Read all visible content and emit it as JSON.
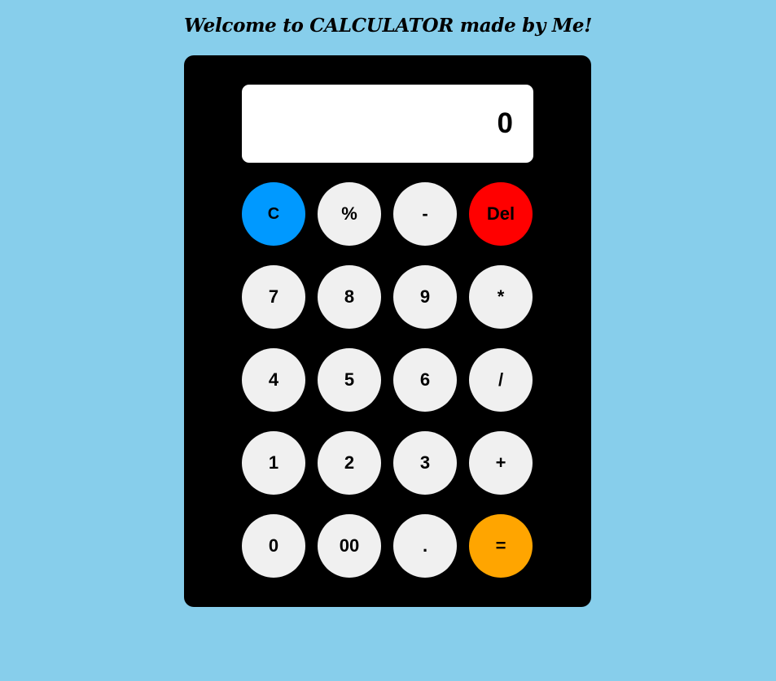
{
  "page": {
    "title": "Welcome to CALCULATOR made by Me!"
  },
  "display": {
    "value": "0"
  },
  "keys": [
    {
      "label": "C",
      "name": "clear-button",
      "variant": "clear"
    },
    {
      "label": "%",
      "name": "percent-button",
      "variant": ""
    },
    {
      "label": "-",
      "name": "subtract-button",
      "variant": ""
    },
    {
      "label": "Del",
      "name": "delete-button",
      "variant": "del"
    },
    {
      "label": "7",
      "name": "digit-7-button",
      "variant": ""
    },
    {
      "label": "8",
      "name": "digit-8-button",
      "variant": ""
    },
    {
      "label": "9",
      "name": "digit-9-button",
      "variant": ""
    },
    {
      "label": "*",
      "name": "multiply-button",
      "variant": ""
    },
    {
      "label": "4",
      "name": "digit-4-button",
      "variant": ""
    },
    {
      "label": "5",
      "name": "digit-5-button",
      "variant": ""
    },
    {
      "label": "6",
      "name": "digit-6-button",
      "variant": ""
    },
    {
      "label": "/",
      "name": "divide-button",
      "variant": ""
    },
    {
      "label": "1",
      "name": "digit-1-button",
      "variant": ""
    },
    {
      "label": "2",
      "name": "digit-2-button",
      "variant": ""
    },
    {
      "label": "3",
      "name": "digit-3-button",
      "variant": ""
    },
    {
      "label": "+",
      "name": "add-button",
      "variant": ""
    },
    {
      "label": "0",
      "name": "digit-0-button",
      "variant": ""
    },
    {
      "label": "00",
      "name": "double-zero-button",
      "variant": ""
    },
    {
      "label": ".",
      "name": "decimal-point-button",
      "variant": ""
    },
    {
      "label": "=",
      "name": "equals-button",
      "variant": "equals"
    }
  ],
  "colors": {
    "page_background": "#87ceeb",
    "calculator_body": "#000000",
    "key_default": "#f0f0f0",
    "key_clear": "#0099ff",
    "key_delete": "#ff0000",
    "key_equals": "#ffa500"
  }
}
